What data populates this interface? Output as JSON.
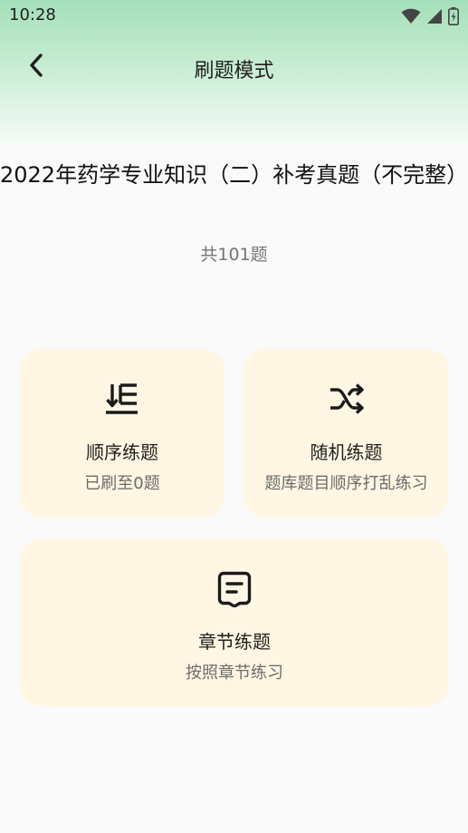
{
  "status_bar": {
    "time": "10:28",
    "icons": [
      "wifi-icon",
      "signal-icon",
      "battery-charging-icon"
    ]
  },
  "toolbar": {
    "back_icon": "chevron-left-icon",
    "title": "刷题模式"
  },
  "exam": {
    "title": "2022年药学专业知识（二）补考真题（不完整）",
    "count_text": "共101题"
  },
  "modes": {
    "sequential": {
      "icon": "sort-list-icon",
      "title": "顺序练题",
      "subtitle": "已刷至0题"
    },
    "random": {
      "icon": "shuffle-icon",
      "title": "随机练题",
      "subtitle": "题库题目顺序打乱练习"
    },
    "chapter": {
      "icon": "chapter-note-icon",
      "title": "章节练题",
      "subtitle": "按照章节练习"
    }
  },
  "colors": {
    "header_gradient_top": "#a4dfb9",
    "header_gradient_bottom": "#f5fbf7",
    "card_background": "#fff6e3",
    "page_background": "#fafafa"
  }
}
